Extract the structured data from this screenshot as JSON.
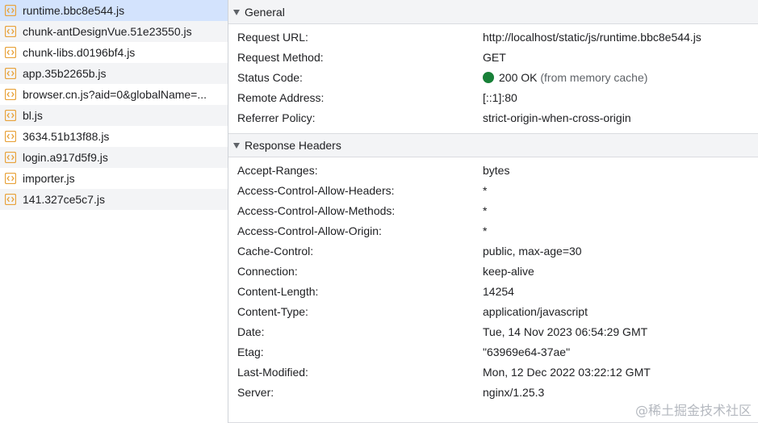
{
  "files": [
    {
      "name": "runtime.bbc8e544.js",
      "selected": true
    },
    {
      "name": "chunk-antDesignVue.51e23550.js",
      "selected": false
    },
    {
      "name": "chunk-libs.d0196bf4.js",
      "selected": false
    },
    {
      "name": "app.35b2265b.js",
      "selected": false
    },
    {
      "name": "browser.cn.js?aid=0&globalName=...",
      "selected": false
    },
    {
      "name": "bl.js",
      "selected": false
    },
    {
      "name": "3634.51b13f88.js",
      "selected": false
    },
    {
      "name": "login.a917d5f9.js",
      "selected": false
    },
    {
      "name": "importer.js",
      "selected": false
    },
    {
      "name": "141.327ce5c7.js",
      "selected": false
    }
  ],
  "general": {
    "title": "General",
    "rows": [
      {
        "key": "Request URL:",
        "value": "http://localhost/static/js/runtime.bbc8e544.js"
      },
      {
        "key": "Request Method:",
        "value": "GET"
      },
      {
        "key": "Status Code:",
        "value": "200 OK",
        "value_sub": "(from memory cache)"
      },
      {
        "key": "Remote Address:",
        "value": "[::1]:80"
      },
      {
        "key": "Referrer Policy:",
        "value": "strict-origin-when-cross-origin"
      }
    ]
  },
  "response_headers": {
    "title": "Response Headers",
    "rows": [
      {
        "key": "Accept-Ranges:",
        "value": "bytes"
      },
      {
        "key": "Access-Control-Allow-Headers:",
        "value": "*"
      },
      {
        "key": "Access-Control-Allow-Methods:",
        "value": "*"
      },
      {
        "key": "Access-Control-Allow-Origin:",
        "value": "*"
      },
      {
        "key": "Cache-Control:",
        "value": "public, max-age=30"
      },
      {
        "key": "Connection:",
        "value": "keep-alive"
      },
      {
        "key": "Content-Length:",
        "value": "14254"
      },
      {
        "key": "Content-Type:",
        "value": "application/javascript"
      },
      {
        "key": "Date:",
        "value": "Tue, 14 Nov 2023 06:54:29 GMT"
      },
      {
        "key": "Etag:",
        "value": "\"63969e64-37ae\""
      },
      {
        "key": "Last-Modified:",
        "value": "Mon, 12 Dec 2022 03:22:12 GMT"
      },
      {
        "key": "Server:",
        "value": "nginx/1.25.3"
      }
    ]
  },
  "watermark": "@稀土掘金技术社区",
  "colors": {
    "file_icon": "#e8a23a",
    "status_ok": "#188038",
    "selected_row": "#d3e3fd"
  },
  "icons": {
    "file": "js-file-icon",
    "expand": "triangle-down-icon",
    "status": "status-dot-icon"
  }
}
